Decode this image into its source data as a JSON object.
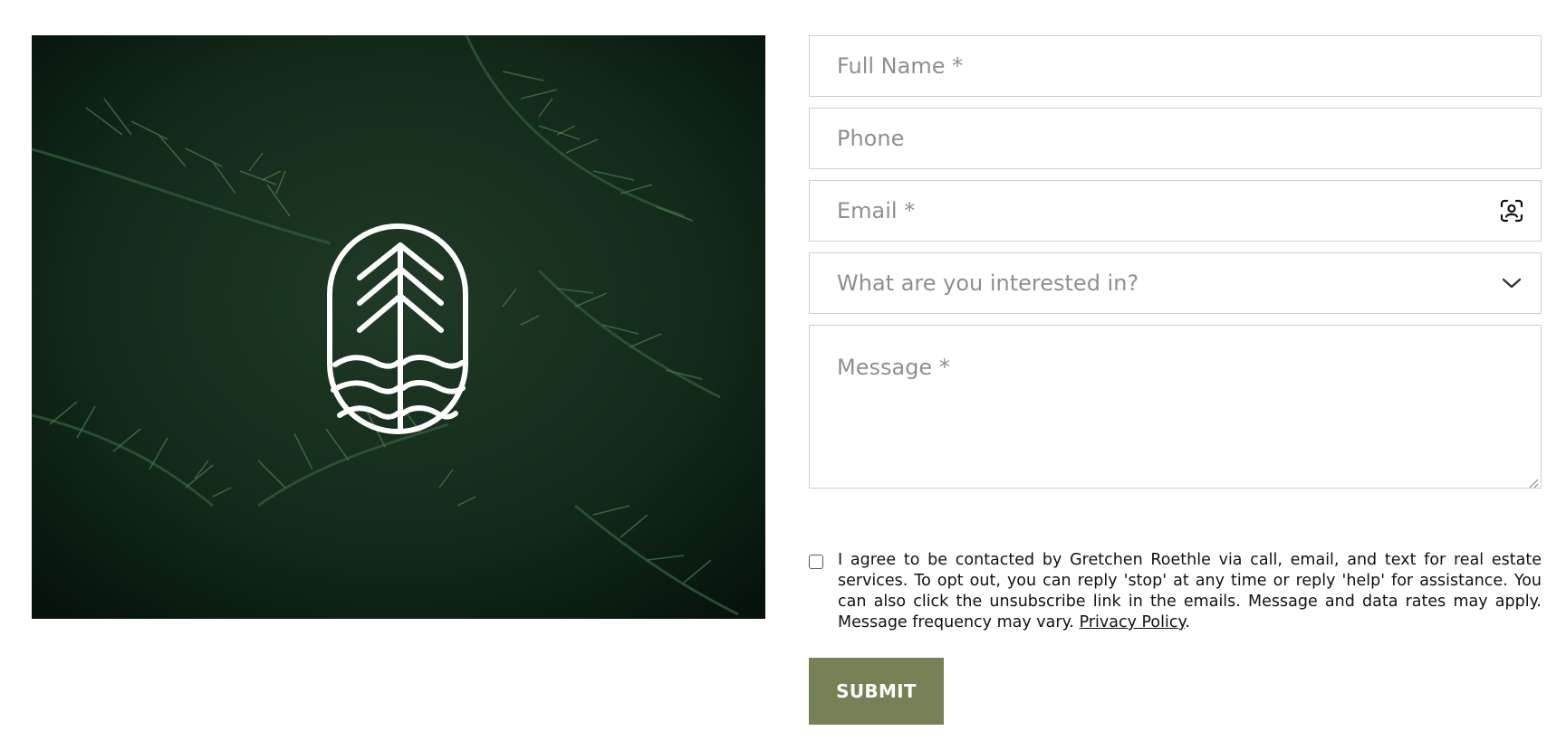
{
  "form": {
    "full_name_placeholder": "Full Name *",
    "phone_placeholder": "Phone",
    "email_placeholder": "Email *",
    "interest_placeholder": "What are you interested in?",
    "message_placeholder": "Message *",
    "consent_text": "I agree to be contacted by Gretchen Roethle via call, email, and text for real estate services. To opt out, you can reply 'stop' at any time or reply 'help' for assistance. You can also click the unsubscribe link in the emails. Message and data rates may apply. Message frequency may vary.",
    "privacy_link": "Privacy Policy",
    "privacy_suffix": ".",
    "submit_label": "SUBMIT"
  },
  "icons": {
    "logo": "pine-tree-waves-logo",
    "email_field": "contact-card-icon",
    "select_arrow": "chevron-down-icon"
  },
  "colors": {
    "accent": "#768155",
    "photo_background": "#0d1f14",
    "border": "#cfcfcf",
    "placeholder": "#8f8f8f"
  }
}
